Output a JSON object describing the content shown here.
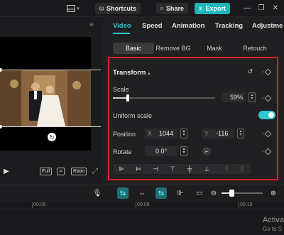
{
  "topbar": {
    "shortcuts_label": "Shortcuts",
    "share_label": "Share",
    "export_label": "Export"
  },
  "player": {
    "buttons": {
      "full": "Full",
      "ratio": "Ratio"
    }
  },
  "inspector": {
    "tabs": [
      "Video",
      "Speed",
      "Animation",
      "Tracking",
      "Adjustme"
    ],
    "sub_tabs": [
      "Basic",
      "Remove BG",
      "Mask",
      "Retouch"
    ],
    "transform": {
      "title": "Transform",
      "scale_label": "Scale",
      "scale_value": "59%",
      "scale_fraction": 0.59,
      "uniform_scale_label": "Uniform scale",
      "uniform_scale_on": true,
      "position_label": "Position",
      "x_label": "X",
      "x_value": "1044",
      "y_label": "Y",
      "y_value": "-116",
      "rotate_label": "Rotate",
      "rotate_value": "0.0°"
    }
  },
  "timeline": {
    "ticks": [
      "00:06",
      "00:08",
      "00:10"
    ]
  },
  "watermark": {
    "line1": "Activa",
    "line2": "Go to S"
  },
  "colors": {
    "accent": "#2fc7cf",
    "highlight_border": "#d8212c",
    "export_bg": "#1fb5bb"
  }
}
